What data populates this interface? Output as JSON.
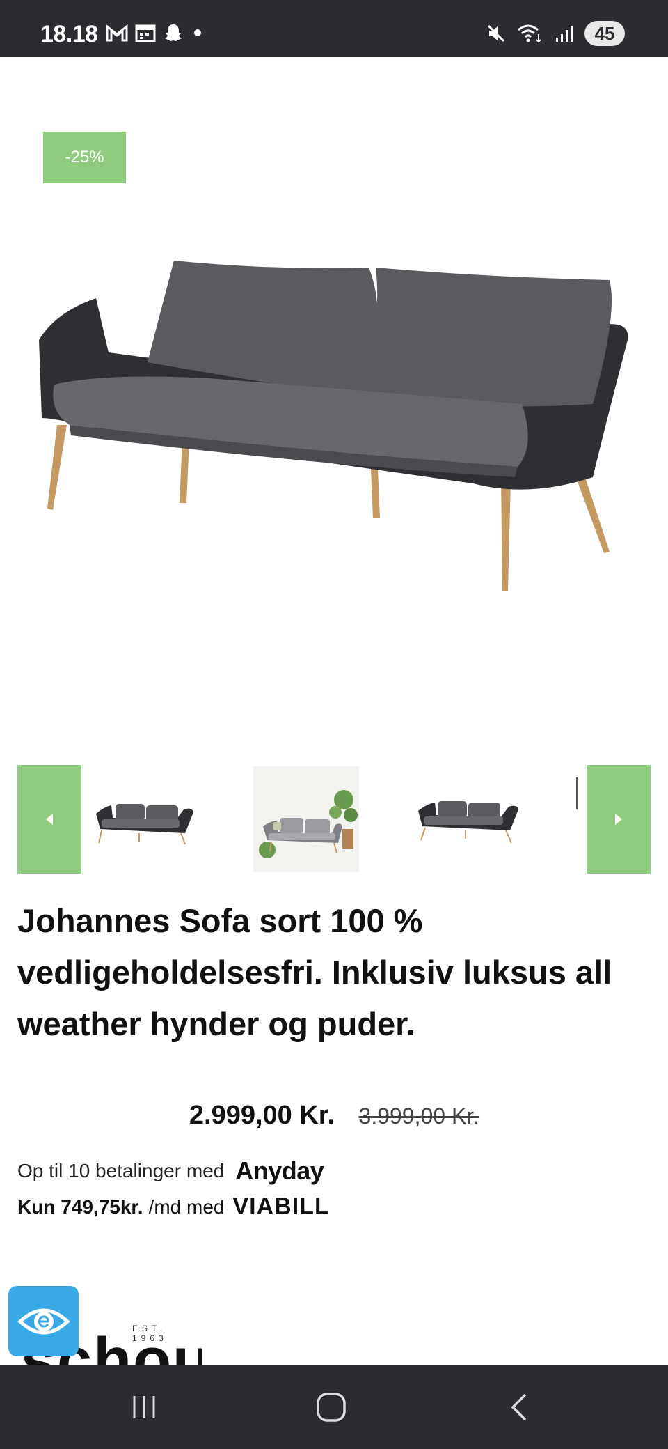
{
  "status_bar": {
    "time": "18.18",
    "battery": "45",
    "left_icons": [
      "gmail-icon",
      "calendar-icon",
      "snapchat-icon",
      "dot-icon"
    ],
    "right_icons": [
      "mute-icon",
      "wifi-icon",
      "signal-icon"
    ]
  },
  "product": {
    "discount_badge": "-25%",
    "title": "Johannes Sofa sort 100 % vedligeholdelsesfri. Inklusiv luksus all weather hynder og puder.",
    "price": "2.999,00 Kr.",
    "old_price": "3.999,00 Kr.",
    "payment_line1_text": "Op til 10 betalinger med",
    "payment_line1_brand": "Anyday",
    "payment_line2_amount": "Kun 749,75kr.",
    "payment_line2_text": "/md med",
    "payment_line2_brand": "VIABILL"
  },
  "logo": {
    "est": "EST. 1963",
    "text": "schou"
  },
  "colors": {
    "accent_green": "#8fcc7f",
    "status_bar": "#2b2c30",
    "accessibility_blue": "#3aaae6"
  }
}
